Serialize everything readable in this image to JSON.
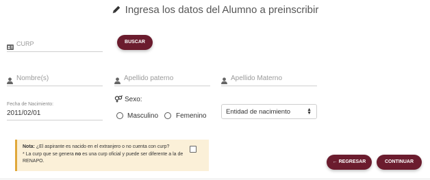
{
  "header": {
    "title": "Ingresa los datos del Alumno a preinscribir",
    "icon": "pencil-icon"
  },
  "curp": {
    "placeholder": "CURP",
    "icon": "id-card-icon",
    "search_label": "BUSCAR"
  },
  "nombre": {
    "placeholder": "Nombre(s)",
    "icon": "user-icon"
  },
  "apellido_paterno": {
    "placeholder": "Apellido paterno",
    "icon": "user-icon"
  },
  "apellido_materno": {
    "placeholder": "Apellido Materno",
    "icon": "user-icon"
  },
  "fecha": {
    "label": "Fecha de Nacimiento:",
    "value": "2011/02/01"
  },
  "sexo": {
    "label": "Sexo:",
    "icon": "gender-icon",
    "options": [
      "Masculino",
      "Femenino"
    ]
  },
  "entidad": {
    "selected": "Entidad de nacimiento"
  },
  "nota": {
    "title": "Nota:",
    "question": "¿El aspirante es nacido en el extranjero o no cuenta con curp?",
    "detail_start": "* La curp que se genera ",
    "detail_bold": "no",
    "detail_end": " es una curp oficial y puede ser diferente a la de RENAPO."
  },
  "actions": {
    "back_label": "REGRESAR",
    "continue_label": "CONTINUAR"
  },
  "colors": {
    "primary": "#6b1c2e",
    "note_bg": "#fbf0d8",
    "note_border": "#e0a83a"
  }
}
